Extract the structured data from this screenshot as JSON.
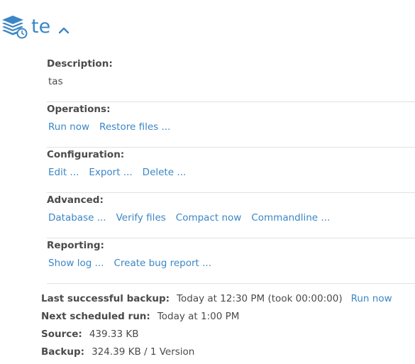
{
  "header": {
    "title": "te",
    "logo_icon": "database-clock-icon",
    "collapse_icon": "chevron-up-icon",
    "accent": "#3b86c6"
  },
  "sections": {
    "description": {
      "label": "Description:",
      "value": "tas"
    },
    "operations": {
      "label": "Operations:",
      "run_now": "Run now",
      "restore": "Restore files ..."
    },
    "configuration": {
      "label": "Configuration:",
      "edit": "Edit ...",
      "export": "Export ...",
      "delete": "Delete ..."
    },
    "advanced": {
      "label": "Advanced:",
      "database": "Database ...",
      "verify": "Verify files",
      "compact": "Compact now",
      "commandline": "Commandline ..."
    },
    "reporting": {
      "label": "Reporting:",
      "show_log": "Show log ...",
      "bug_report": "Create bug report ..."
    }
  },
  "status": {
    "last_backup_label": "Last successful backup:",
    "last_backup_value": "Today at 12:30 PM (took 00:00:00)",
    "run_now": "Run now",
    "next_run_label": "Next scheduled run:",
    "next_run_value": "Today at 1:00 PM",
    "source_label": "Source:",
    "source_value": "439.33 KB",
    "backup_label": "Backup:",
    "backup_value": "324.39 KB / 1 Version"
  }
}
